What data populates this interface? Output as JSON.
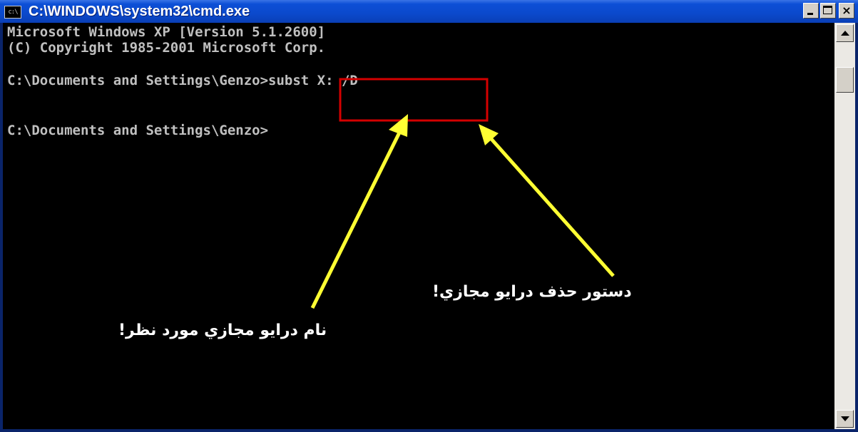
{
  "window": {
    "title": "C:\\WINDOWS\\system32\\cmd.exe",
    "icon": "cmd-icon",
    "icon_glyph": "c:\\",
    "buttons": {
      "minimize_icon": "minimize-icon",
      "maximize_icon": "maximize-icon",
      "close_icon": "close-icon",
      "close_glyph": "×"
    }
  },
  "console": {
    "lines": [
      "Microsoft Windows XP [Version 5.1.2600]",
      "(C) Copyright 1985-2001 Microsoft Corp.",
      "",
      "C:\\Documents and Settings\\Genzo>subst X: /D",
      "",
      "C:\\Documents and Settings\\Genzo>"
    ],
    "text_color": "#c0c0c0",
    "background_color": "#000000"
  },
  "annotations": {
    "highlight_color": "#d40000",
    "arrow_color": "#ffff33",
    "label_delete_command": "دستور حذف درايو مجازي!",
    "label_drive_name": "نام درايو مجازي مورد نظر!"
  },
  "colors": {
    "titlebar": "#0b49cc",
    "scrollbar_track": "#ebe9e4",
    "button_face": "#d4d0c8"
  }
}
